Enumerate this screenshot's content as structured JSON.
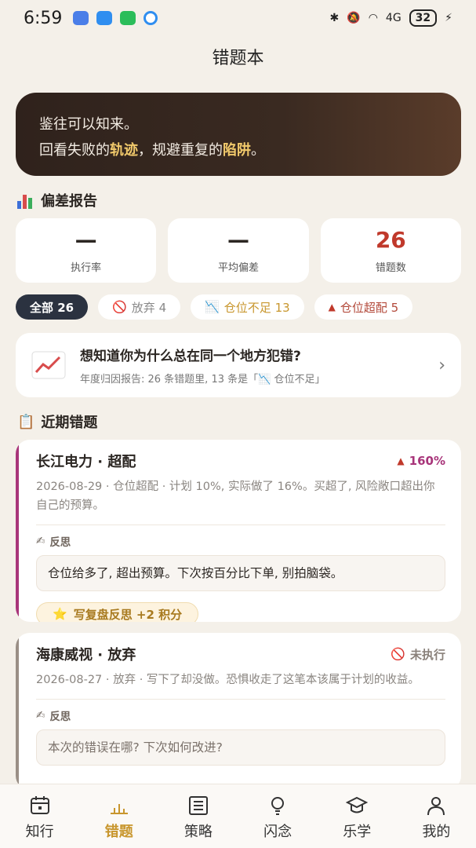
{
  "status": {
    "time": "6:59",
    "battery": "32",
    "network": "4G"
  },
  "page_title": "错题本",
  "hero": {
    "line1": "鉴往可以知来。",
    "line2_a": "回看失败的",
    "line2_b": "轨迹",
    "line2_c": "，规避重复的",
    "line2_d": "陷阱",
    "line2_e": "。"
  },
  "report": {
    "title": "偏差报告",
    "stats": [
      {
        "value": "—",
        "label": "执行率"
      },
      {
        "value": "—",
        "label": "平均偏差"
      },
      {
        "value": "26",
        "label": "错题数"
      }
    ]
  },
  "filters": [
    {
      "label": "全部 26"
    },
    {
      "icon": "🚫",
      "label": "放弃 4"
    },
    {
      "icon": "📉",
      "label": "仓位不足 13"
    },
    {
      "icon": "▲",
      "label": "仓位超配 5"
    }
  ],
  "promo": {
    "title": "想知道你为什么总在同一个地方犯错?",
    "subtitle": "年度归因报告: 26 条错题里, 13 条是「📉 仓位不足」"
  },
  "recent": {
    "title": "近期错题"
  },
  "cards": [
    {
      "title": "长江电力 · 超配",
      "badge": "160%",
      "desc": "2026-08-29 · 仓位超配 · 计划 10%, 实际做了 16%。买超了, 风险敞口超出你自己的预算。",
      "reflect_label": "反思",
      "reflect_text": "仓位给多了, 超出预算。下次按百分比下单, 别拍脑袋。",
      "reward": "写复盘反思 +2 积分"
    },
    {
      "title": "海康威视 · 放弃",
      "badge": "未执行",
      "desc": "2026-08-27 · 放弃 · 写下了却没做。恐惧收走了这笔本该属于计划的收益。",
      "reflect_label": "反思",
      "reflect_placeholder": "本次的错误在哪? 下次如何改进?"
    }
  ],
  "tabs": [
    {
      "label": "知行",
      "icon": "calendar-icon"
    },
    {
      "label": "错题",
      "icon": "bar-chart-icon"
    },
    {
      "label": "策略",
      "icon": "list-icon"
    },
    {
      "label": "闪念",
      "icon": "lightbulb-icon"
    },
    {
      "label": "乐学",
      "icon": "graduation-cap-icon"
    },
    {
      "label": "我的",
      "icon": "user-icon"
    }
  ],
  "colors": {
    "accent": "#c8962d",
    "hero_bg": "#2f221c",
    "danger": "#c0392b",
    "purple": "#a8357a"
  }
}
